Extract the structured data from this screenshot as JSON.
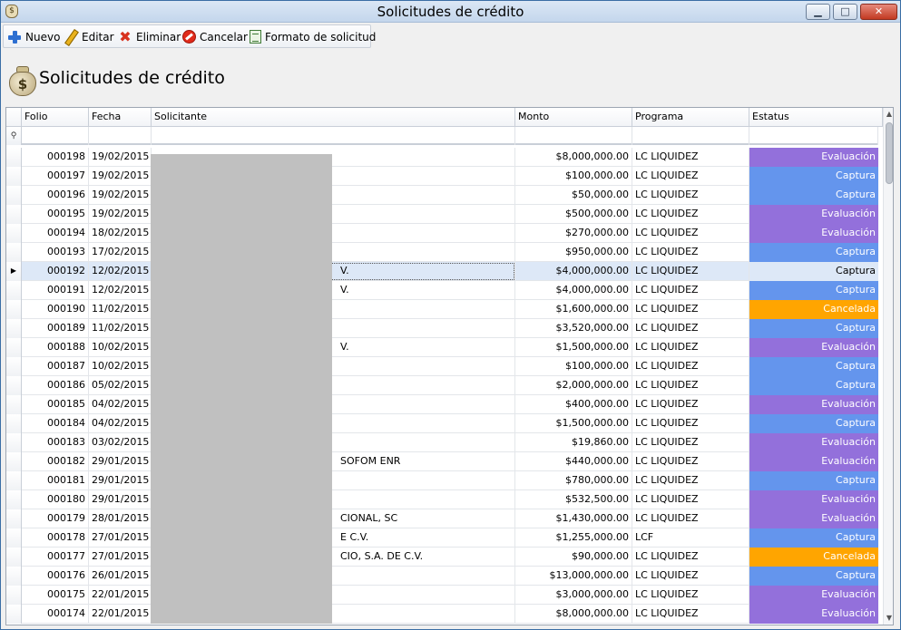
{
  "window": {
    "title": "Solicitudes de crédito",
    "app_icon": "money-bag-icon",
    "min": "▁",
    "max": "□",
    "close": "✕"
  },
  "toolbar": {
    "nuevo": "Nuevo",
    "editar": "Editar",
    "eliminar": "Eliminar",
    "cancelar": "Cancelar",
    "formato": "Formato de solicitud"
  },
  "heading": {
    "title": "Solicitudes de crédito",
    "icon": "money-bag-icon",
    "icon_glyph": "$"
  },
  "grid": {
    "columns": [
      "Folio",
      "Fecha",
      "Solicitante",
      "Monto",
      "Programa",
      "Estatus"
    ],
    "filter_glyph": "⚲",
    "row_pointer": "▶",
    "rows": [
      {
        "folio": "000198",
        "fecha": "19/02/2015",
        "solicitante": "",
        "monto": "$8,000,000.00",
        "programa": "LC LIQUIDEZ",
        "estatus": "Evaluación"
      },
      {
        "folio": "000197",
        "fecha": "19/02/2015",
        "solicitante": "",
        "monto": "$100,000.00",
        "programa": "LC LIQUIDEZ",
        "estatus": "Captura"
      },
      {
        "folio": "000196",
        "fecha": "19/02/2015",
        "solicitante": "",
        "monto": "$50,000.00",
        "programa": "LC LIQUIDEZ",
        "estatus": "Captura"
      },
      {
        "folio": "000195",
        "fecha": "19/02/2015",
        "solicitante": "",
        "monto": "$500,000.00",
        "programa": "LC LIQUIDEZ",
        "estatus": "Evaluación"
      },
      {
        "folio": "000194",
        "fecha": "18/02/2015",
        "solicitante": "",
        "monto": "$270,000.00",
        "programa": "LC LIQUIDEZ",
        "estatus": "Evaluación"
      },
      {
        "folio": "000193",
        "fecha": "17/02/2015",
        "solicitante": "",
        "monto": "$950,000.00",
        "programa": "LC LIQUIDEZ",
        "estatus": "Captura"
      },
      {
        "folio": "000192",
        "fecha": "12/02/2015",
        "solicitante": "V.",
        "monto": "$4,000,000.00",
        "programa": "LC LIQUIDEZ",
        "estatus": "Captura",
        "selected": true
      },
      {
        "folio": "000191",
        "fecha": "12/02/2015",
        "solicitante": "V.",
        "monto": "$4,000,000.00",
        "programa": "LC LIQUIDEZ",
        "estatus": "Captura"
      },
      {
        "folio": "000190",
        "fecha": "11/02/2015",
        "solicitante": "",
        "monto": "$1,600,000.00",
        "programa": "LC LIQUIDEZ",
        "estatus": "Cancelada"
      },
      {
        "folio": "000189",
        "fecha": "11/02/2015",
        "solicitante": "",
        "monto": "$3,520,000.00",
        "programa": "LC LIQUIDEZ",
        "estatus": "Captura"
      },
      {
        "folio": "000188",
        "fecha": "10/02/2015",
        "solicitante": "V.",
        "monto": "$1,500,000.00",
        "programa": "LC LIQUIDEZ",
        "estatus": "Evaluación"
      },
      {
        "folio": "000187",
        "fecha": "10/02/2015",
        "solicitante": "",
        "monto": "$100,000.00",
        "programa": "LC LIQUIDEZ",
        "estatus": "Captura"
      },
      {
        "folio": "000186",
        "fecha": "05/02/2015",
        "solicitante": "",
        "monto": "$2,000,000.00",
        "programa": "LC LIQUIDEZ",
        "estatus": "Captura"
      },
      {
        "folio": "000185",
        "fecha": "04/02/2015",
        "solicitante": "",
        "monto": "$400,000.00",
        "programa": "LC LIQUIDEZ",
        "estatus": "Evaluación"
      },
      {
        "folio": "000184",
        "fecha": "04/02/2015",
        "solicitante": "",
        "monto": "$1,500,000.00",
        "programa": "LC LIQUIDEZ",
        "estatus": "Captura"
      },
      {
        "folio": "000183",
        "fecha": "03/02/2015",
        "solicitante": "",
        "monto": "$19,860.00",
        "programa": "LC LIQUIDEZ",
        "estatus": "Evaluación"
      },
      {
        "folio": "000182",
        "fecha": "29/01/2015",
        "solicitante": "SOFOM ENR",
        "monto": "$440,000.00",
        "programa": "LC LIQUIDEZ",
        "estatus": "Evaluación"
      },
      {
        "folio": "000181",
        "fecha": "29/01/2015",
        "solicitante": "",
        "monto": "$780,000.00",
        "programa": "LC LIQUIDEZ",
        "estatus": "Captura"
      },
      {
        "folio": "000180",
        "fecha": "29/01/2015",
        "solicitante": "",
        "monto": "$532,500.00",
        "programa": "LC LIQUIDEZ",
        "estatus": "Evaluación"
      },
      {
        "folio": "000179",
        "fecha": "28/01/2015",
        "solicitante": "CIONAL, SC",
        "monto": "$1,430,000.00",
        "programa": "LC LIQUIDEZ",
        "estatus": "Evaluación"
      },
      {
        "folio": "000178",
        "fecha": "27/01/2015",
        "solicitante": "E C.V.",
        "monto": "$1,255,000.00",
        "programa": "LCF",
        "estatus": "Captura"
      },
      {
        "folio": "000177",
        "fecha": "27/01/2015",
        "solicitante": "CIO, S.A. DE C.V.",
        "monto": "$90,000.00",
        "programa": "LC LIQUIDEZ",
        "estatus": "Cancelada"
      },
      {
        "folio": "000176",
        "fecha": "26/01/2015",
        "solicitante": "",
        "monto": "$13,000,000.00",
        "programa": "LC LIQUIDEZ",
        "estatus": "Captura"
      },
      {
        "folio": "000175",
        "fecha": "22/01/2015",
        "solicitante": "",
        "monto": "$3,000,000.00",
        "programa": "LC LIQUIDEZ",
        "estatus": "Evaluación"
      },
      {
        "folio": "000174",
        "fecha": "22/01/2015",
        "solicitante": "",
        "monto": "$8,000,000.00",
        "programa": "LC LIQUIDEZ",
        "estatus": "Evaluación"
      }
    ]
  },
  "status_colors": {
    "Evaluación": "#9370db",
    "Captura": "#6495ed",
    "Cancelada": "#ffa500"
  },
  "scrollbar": {
    "up": "▲",
    "down": "▼"
  }
}
